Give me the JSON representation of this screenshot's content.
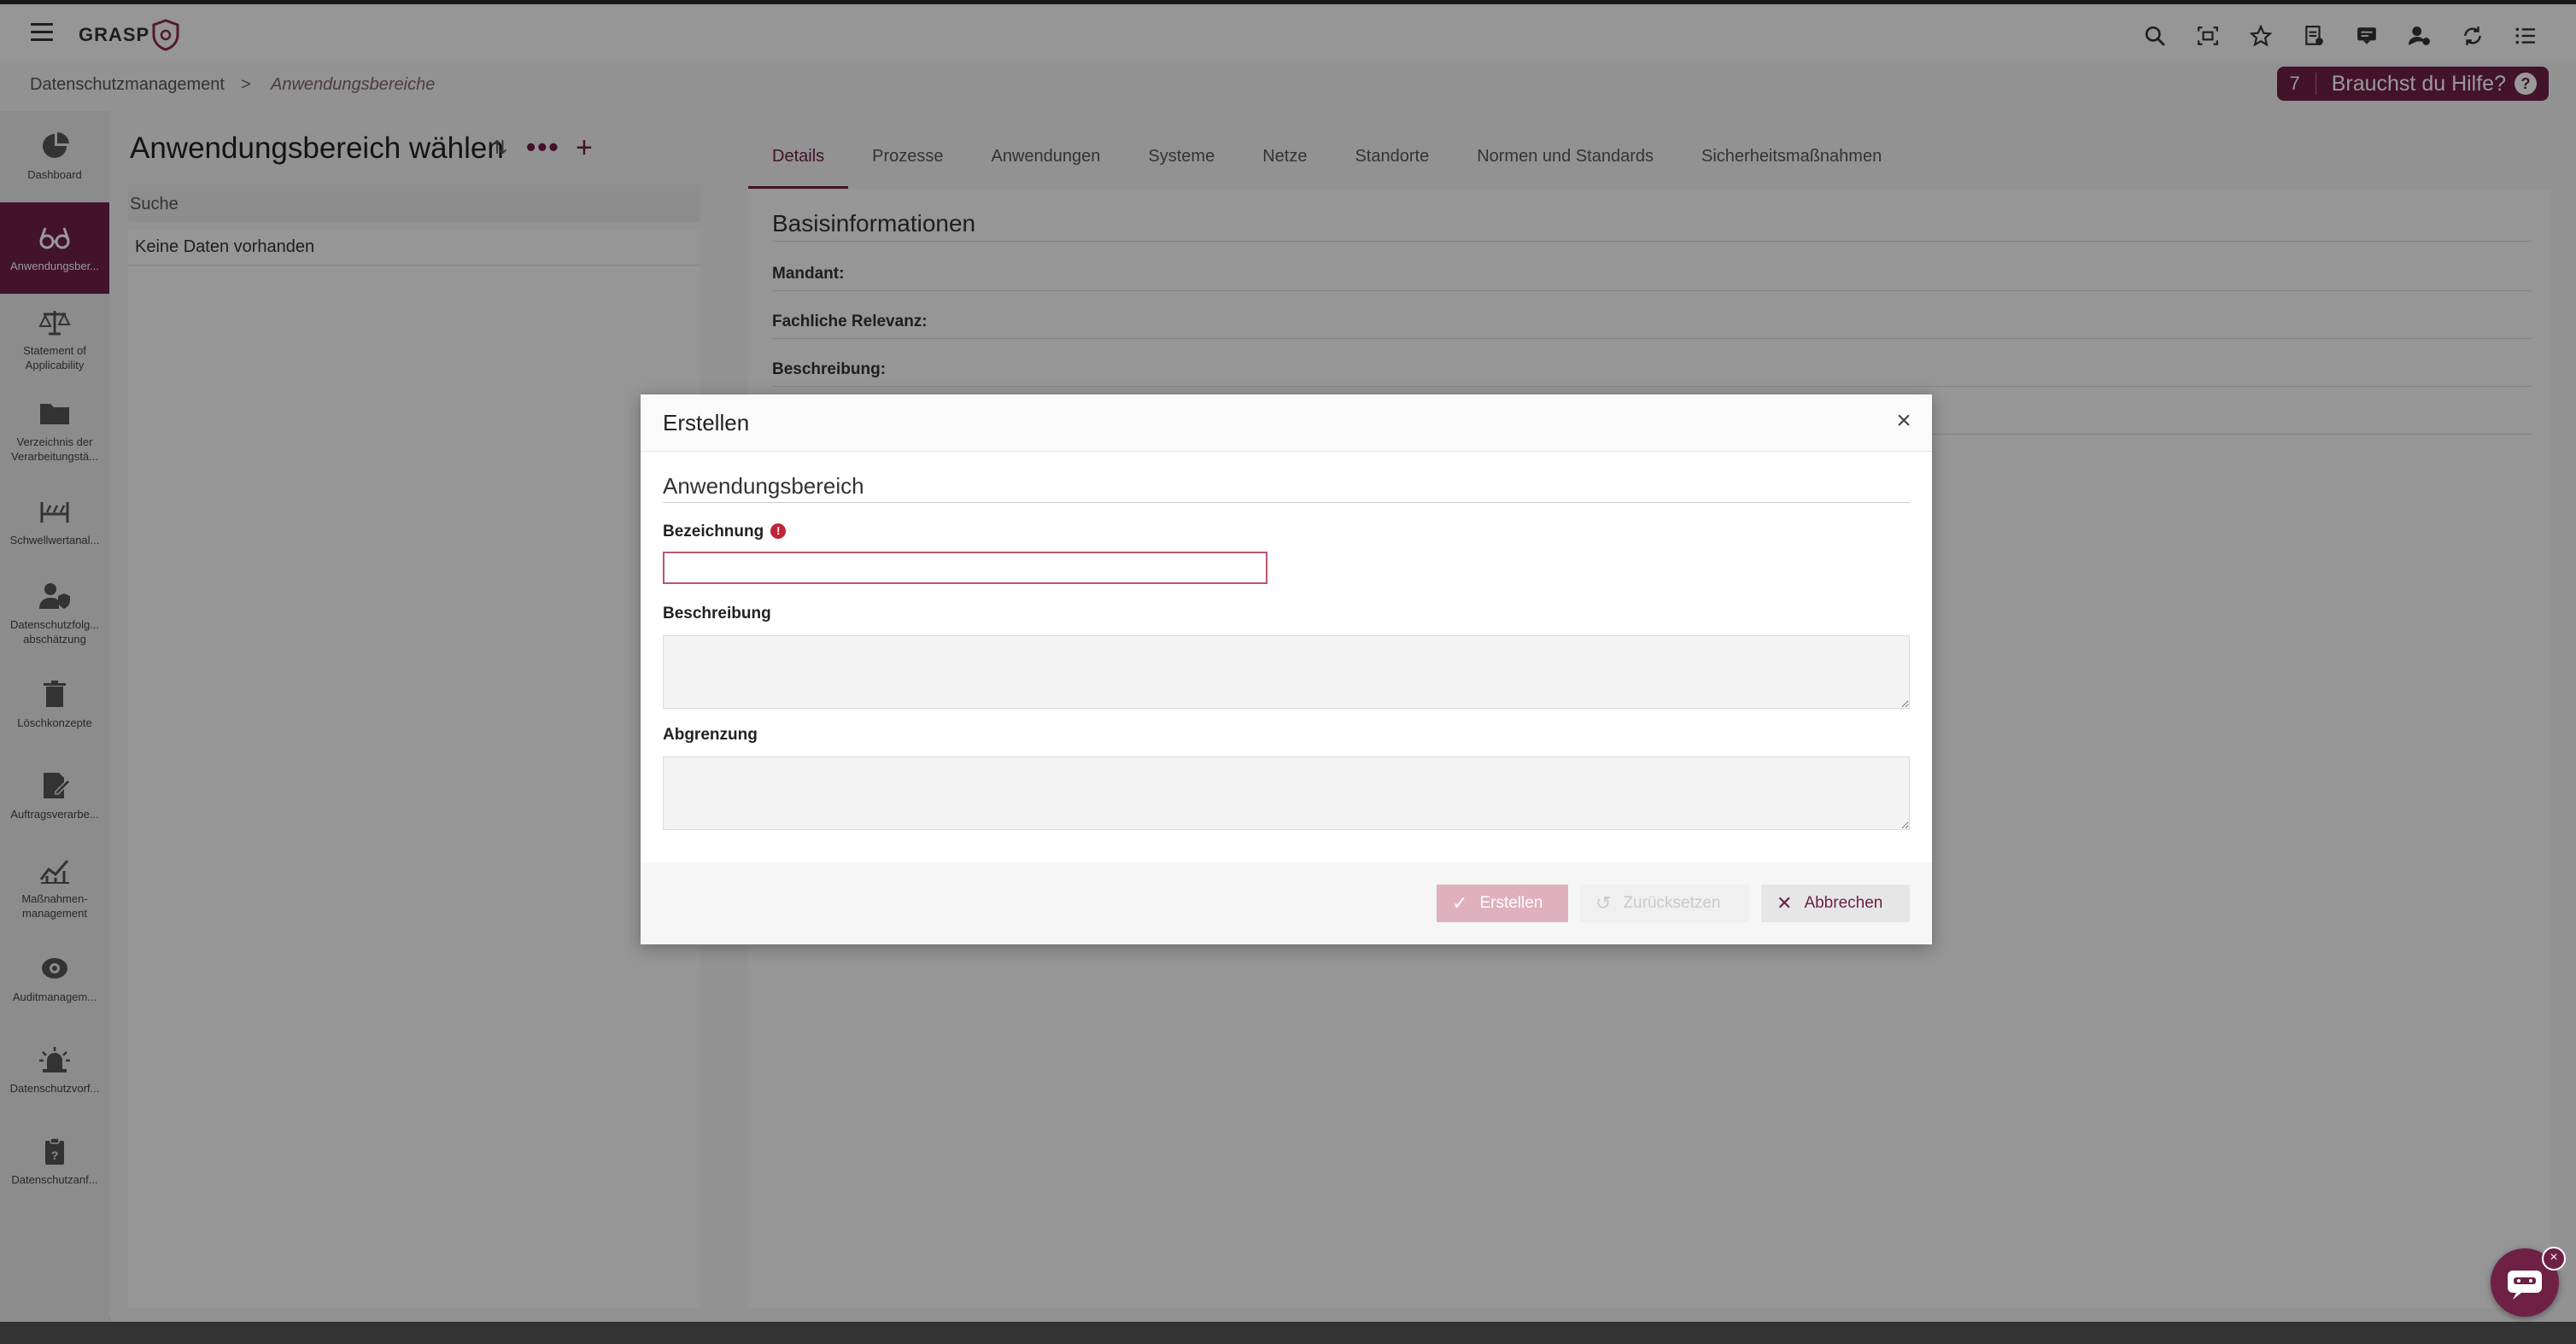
{
  "app": {
    "logo": "GRASP"
  },
  "breadcrumb": {
    "home": "Datenschutzmanagement",
    "separator": ">",
    "current": "Anwendungsbereiche"
  },
  "help": {
    "count": "7",
    "label": "Brauchst du Hilfe?"
  },
  "top_icons": [
    "search-icon",
    "scan-icon",
    "star-icon",
    "document-icon",
    "chat-icon",
    "user-settings-icon",
    "refresh-icon",
    "list-icon"
  ],
  "sidebar": {
    "items": [
      {
        "label": "Dashboard",
        "icon": "pie-chart-icon"
      },
      {
        "label": "Anwendungsber...",
        "icon": "glasses-icon",
        "active": true
      },
      {
        "label": "Statement of Applicability",
        "icon": "scale-icon"
      },
      {
        "label": "Verzeichnis der Verarbeitungstä...",
        "icon": "folder-icon"
      },
      {
        "label": "Schwellwertanal...",
        "icon": "threshold-icon"
      },
      {
        "label": "Datenschutzfolg... abschätzung",
        "icon": "user-shield-icon"
      },
      {
        "label": "Löschkonzepte",
        "icon": "trash-icon"
      },
      {
        "label": "Auftragsverarbe...",
        "icon": "edit-document-icon"
      },
      {
        "label": "Maßnahmen-management",
        "icon": "chart-line-icon"
      },
      {
        "label": "Auditmanagem...",
        "icon": "eye-icon"
      },
      {
        "label": "Datenschutzvorf...",
        "icon": "alarm-icon"
      },
      {
        "label": "Datenschutzanf...",
        "icon": "clipboard-question-icon"
      }
    ]
  },
  "left_panel": {
    "title": "Anwendungsbereich wählen",
    "search_label": "Suche",
    "empty": "Keine Daten vorhanden"
  },
  "tabs": [
    "Details",
    "Prozesse",
    "Anwendungen",
    "Systeme",
    "Netze",
    "Standorte",
    "Normen und Standards",
    "Sicherheitsmaßnahmen"
  ],
  "details": {
    "heading": "Basisinformationen",
    "fields": [
      "Mandant:",
      "Fachliche Relevanz:",
      "Beschreibung:"
    ]
  },
  "modal": {
    "title": "Erstellen",
    "section": "Anwendungsbereich",
    "field_bezeichnung": "Bezeichnung",
    "required_mark": "!",
    "field_beschreibung": "Beschreibung",
    "field_abgrenzung": "Abgrenzung",
    "btn_create": "Erstellen",
    "btn_reset": "Zurücksetzen",
    "btn_cancel": "Abbrechen"
  },
  "colors": {
    "accent": "#6e2145",
    "error": "#c0243d"
  }
}
